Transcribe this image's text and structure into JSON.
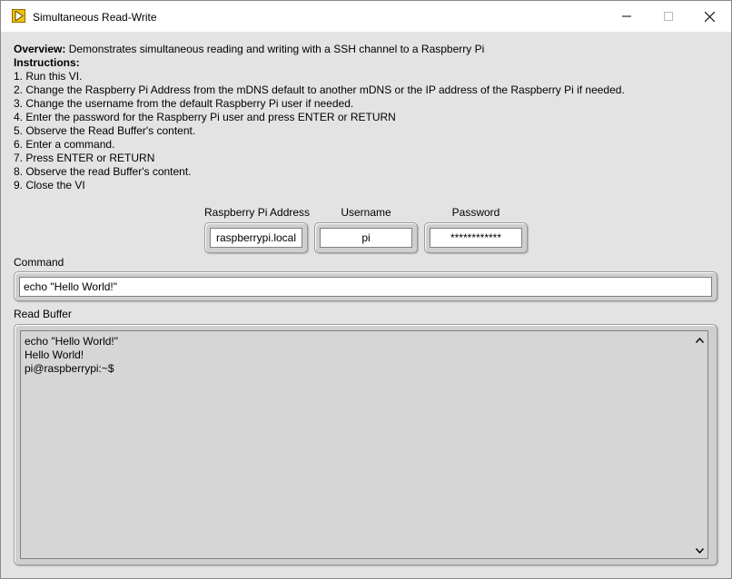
{
  "window": {
    "title": "Simultaneous Read-Write"
  },
  "overview": {
    "label": "Overview:",
    "text": " Demonstrates simultaneous reading and writing with a SSH channel to a Raspberry Pi"
  },
  "instructions": {
    "label": "Instructions:",
    "steps": [
      "1. Run this VI.",
      "2. Change the Raspberry Pi Address from the mDNS default to another mDNS or the IP address of the Raspberry Pi if needed.",
      "3. Change the username from the default Raspberry Pi user if needed.",
      "4. Enter the password for the Raspberry Pi user and press ENTER or RETURN",
      "5. Observe the Read Buffer's content.",
      "6. Enter a command.",
      "7. Press ENTER or RETURN",
      "8. Observe the read Buffer's content.",
      "9. Close the VI"
    ]
  },
  "fields": {
    "address": {
      "label": "Raspberry Pi Address",
      "value": "raspberrypi.local"
    },
    "username": {
      "label": "Username",
      "value": "pi"
    },
    "password": {
      "label": "Password",
      "value": "************"
    }
  },
  "command": {
    "label": "Command",
    "value": "echo \"Hello World!\""
  },
  "read_buffer": {
    "label": "Read Buffer",
    "lines": [
      "echo \"Hello World!\"",
      "Hello World!",
      "pi@raspberrypi:~$"
    ]
  },
  "icons": {
    "app": "labview-run-arrow-icon",
    "minimize": "minimize-icon",
    "maximize": "maximize-icon",
    "close": "close-icon",
    "scroll_up": "chevron-up-icon",
    "scroll_down": "chevron-down-icon"
  },
  "colors": {
    "panel_background": "#e3e3e3",
    "app_icon": "#f2c200",
    "buffer_background": "#d6d6d6"
  }
}
